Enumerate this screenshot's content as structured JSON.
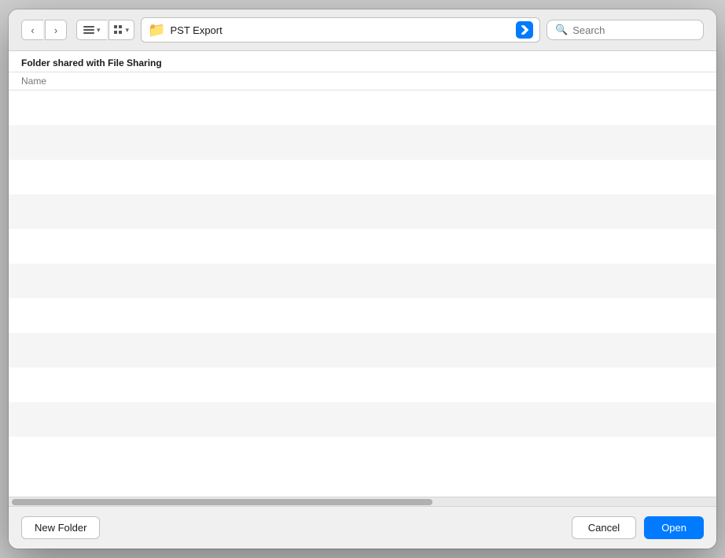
{
  "toolbar": {
    "back_label": "‹",
    "forward_label": "›",
    "list_chevron": "▾",
    "grid_chevron": "▾",
    "location": "PST Export",
    "search_placeholder": "Search"
  },
  "content": {
    "folder_header": "Folder shared with File Sharing",
    "column_name": "Name",
    "rows": [
      {
        "id": 1
      },
      {
        "id": 2
      },
      {
        "id": 3
      },
      {
        "id": 4
      },
      {
        "id": 5
      },
      {
        "id": 6
      },
      {
        "id": 7
      },
      {
        "id": 8
      },
      {
        "id": 9
      },
      {
        "id": 10
      }
    ]
  },
  "footer": {
    "new_folder_label": "New Folder",
    "cancel_label": "Cancel",
    "open_label": "Open"
  }
}
